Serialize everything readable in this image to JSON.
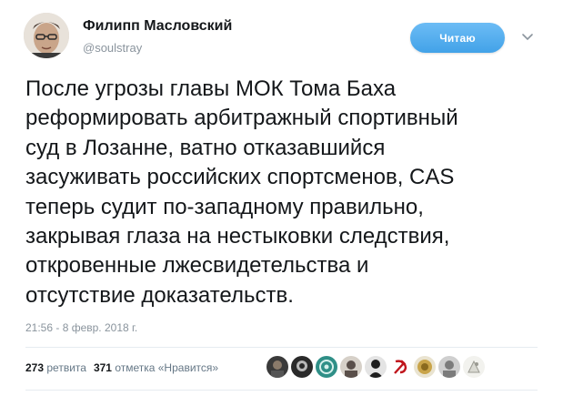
{
  "author": {
    "display_name": "Филипп Масловский",
    "username": "@soulstray"
  },
  "follow_button": {
    "label": "Читаю"
  },
  "tweet": {
    "text": "После угрозы главы МОК Тома Баха\nреформировать арбитражный спортивный\nсуд в Лозанне, ватно отказавшийся\nзасуживать российских спортсменов, CAS\nтеперь судит по-западному правильно,\nзакрывая глаза на нестыковки следствия,\nоткровенные лжесвидетельства и\nотсутствие доказательств.",
    "timestamp": "21:56 - 8 февр. 2018 г."
  },
  "stats": {
    "retweets_count": "273",
    "retweets_label": "ретвита",
    "likes_count": "371",
    "likes_label": "отметка «Нравится»"
  },
  "likers": [
    {
      "icon": "avatar-dark-photo",
      "color": "#3a3a3a"
    },
    {
      "icon": "avatar-dark-figure",
      "color": "#2a2a2a"
    },
    {
      "icon": "avatar-teal-emblem",
      "color": "#2f8f87"
    },
    {
      "icon": "avatar-portrait",
      "color": "#5a4f4a"
    },
    {
      "icon": "avatar-black-figure",
      "color": "#1e1e1e"
    },
    {
      "icon": "hammer-sickle-icon",
      "color": "#c0161d"
    },
    {
      "icon": "avatar-gold-emblem",
      "color": "#c9a449"
    },
    {
      "icon": "avatar-grey-photo",
      "color": "#7c7c7c"
    },
    {
      "icon": "avatar-light-photo",
      "color": "#d9d9d2"
    }
  ],
  "colors": {
    "accent": "#42a2e8",
    "secondary_text": "#8a949d",
    "divider": "#e6ecf0"
  }
}
